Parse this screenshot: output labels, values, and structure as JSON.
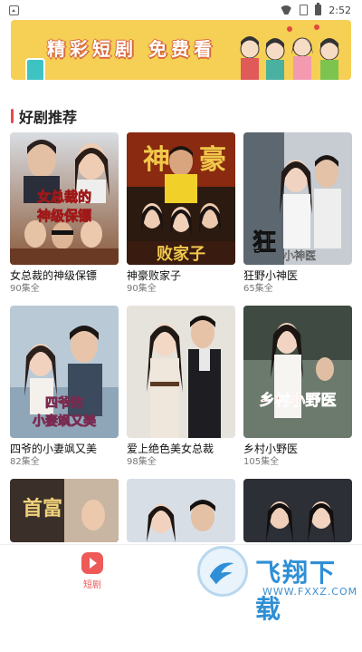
{
  "status_bar": {
    "time": "2:52",
    "icons": [
      "notification-icon",
      "wifi-icon",
      "sim-icon",
      "battery-icon"
    ]
  },
  "banner": {
    "title": "精彩短剧 免费看"
  },
  "section": {
    "title": "好剧推荐",
    "accent_color": "#e84b4b"
  },
  "dramas": [
    {
      "title": "女总裁的神级保镖",
      "count": "90集全",
      "poster_text": "女总裁的神级保镖"
    },
    {
      "title": "神豪败家子",
      "count": "90集全",
      "poster_text": "神豪败家子"
    },
    {
      "title": "狂野小神医",
      "count": "65集全",
      "poster_text": "狂 小神医"
    },
    {
      "title": "四爷的小妻飒又美",
      "count": "82集全",
      "poster_text": "四爷的小妻飒又美"
    },
    {
      "title": "爱上绝色美女总裁",
      "count": "98集全",
      "poster_text": ""
    },
    {
      "title": "乡村小野医",
      "count": "105集全",
      "poster_text": "乡村小野医"
    },
    {
      "title": "",
      "count": "",
      "poster_text": "首富"
    },
    {
      "title": "",
      "count": "",
      "poster_text": ""
    },
    {
      "title": "",
      "count": "",
      "poster_text": ""
    }
  ],
  "tabbar": {
    "tab_label": "短剧",
    "accent_color": "#ee5a58"
  },
  "watermark": {
    "brand": "飞翔下载",
    "url": "WWW.FXXZ.COM"
  }
}
